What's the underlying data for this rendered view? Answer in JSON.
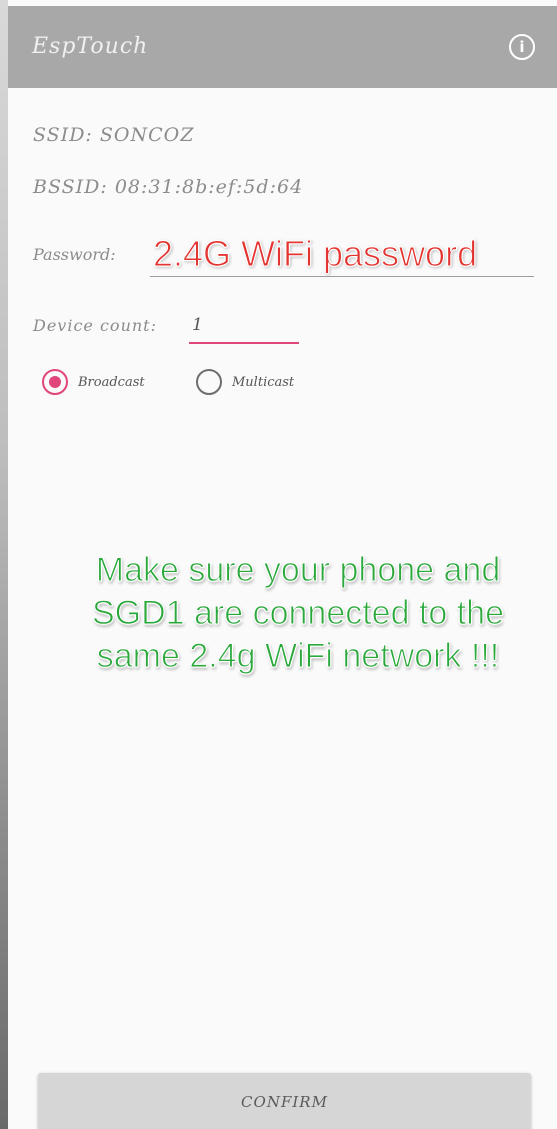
{
  "app_bar": {
    "title": "EspTouch",
    "info_icon": "info-icon",
    "info_glyph": "i",
    "background": "#a8a8a8"
  },
  "wifi": {
    "ssid_text": "SSID: SONCOZ",
    "bssid_text": "BSSID: 08:31:8b:ef:5d:64"
  },
  "form": {
    "password_label": "Password:",
    "password_value": "",
    "password_overlay": "2.4G WiFi password",
    "device_count_label": "Device count:",
    "device_count_value": "1",
    "accent_color": "#e0457b"
  },
  "mode": {
    "options": [
      {
        "label": "Broadcast",
        "selected": true
      },
      {
        "label": "Multicast",
        "selected": false
      }
    ]
  },
  "notice": {
    "text": "Make sure your phone and SGD1 are connected to the same 2.4g WiFi network !!!",
    "color": "#2aa83a"
  },
  "confirm_button": {
    "label": "CONFIRM"
  }
}
